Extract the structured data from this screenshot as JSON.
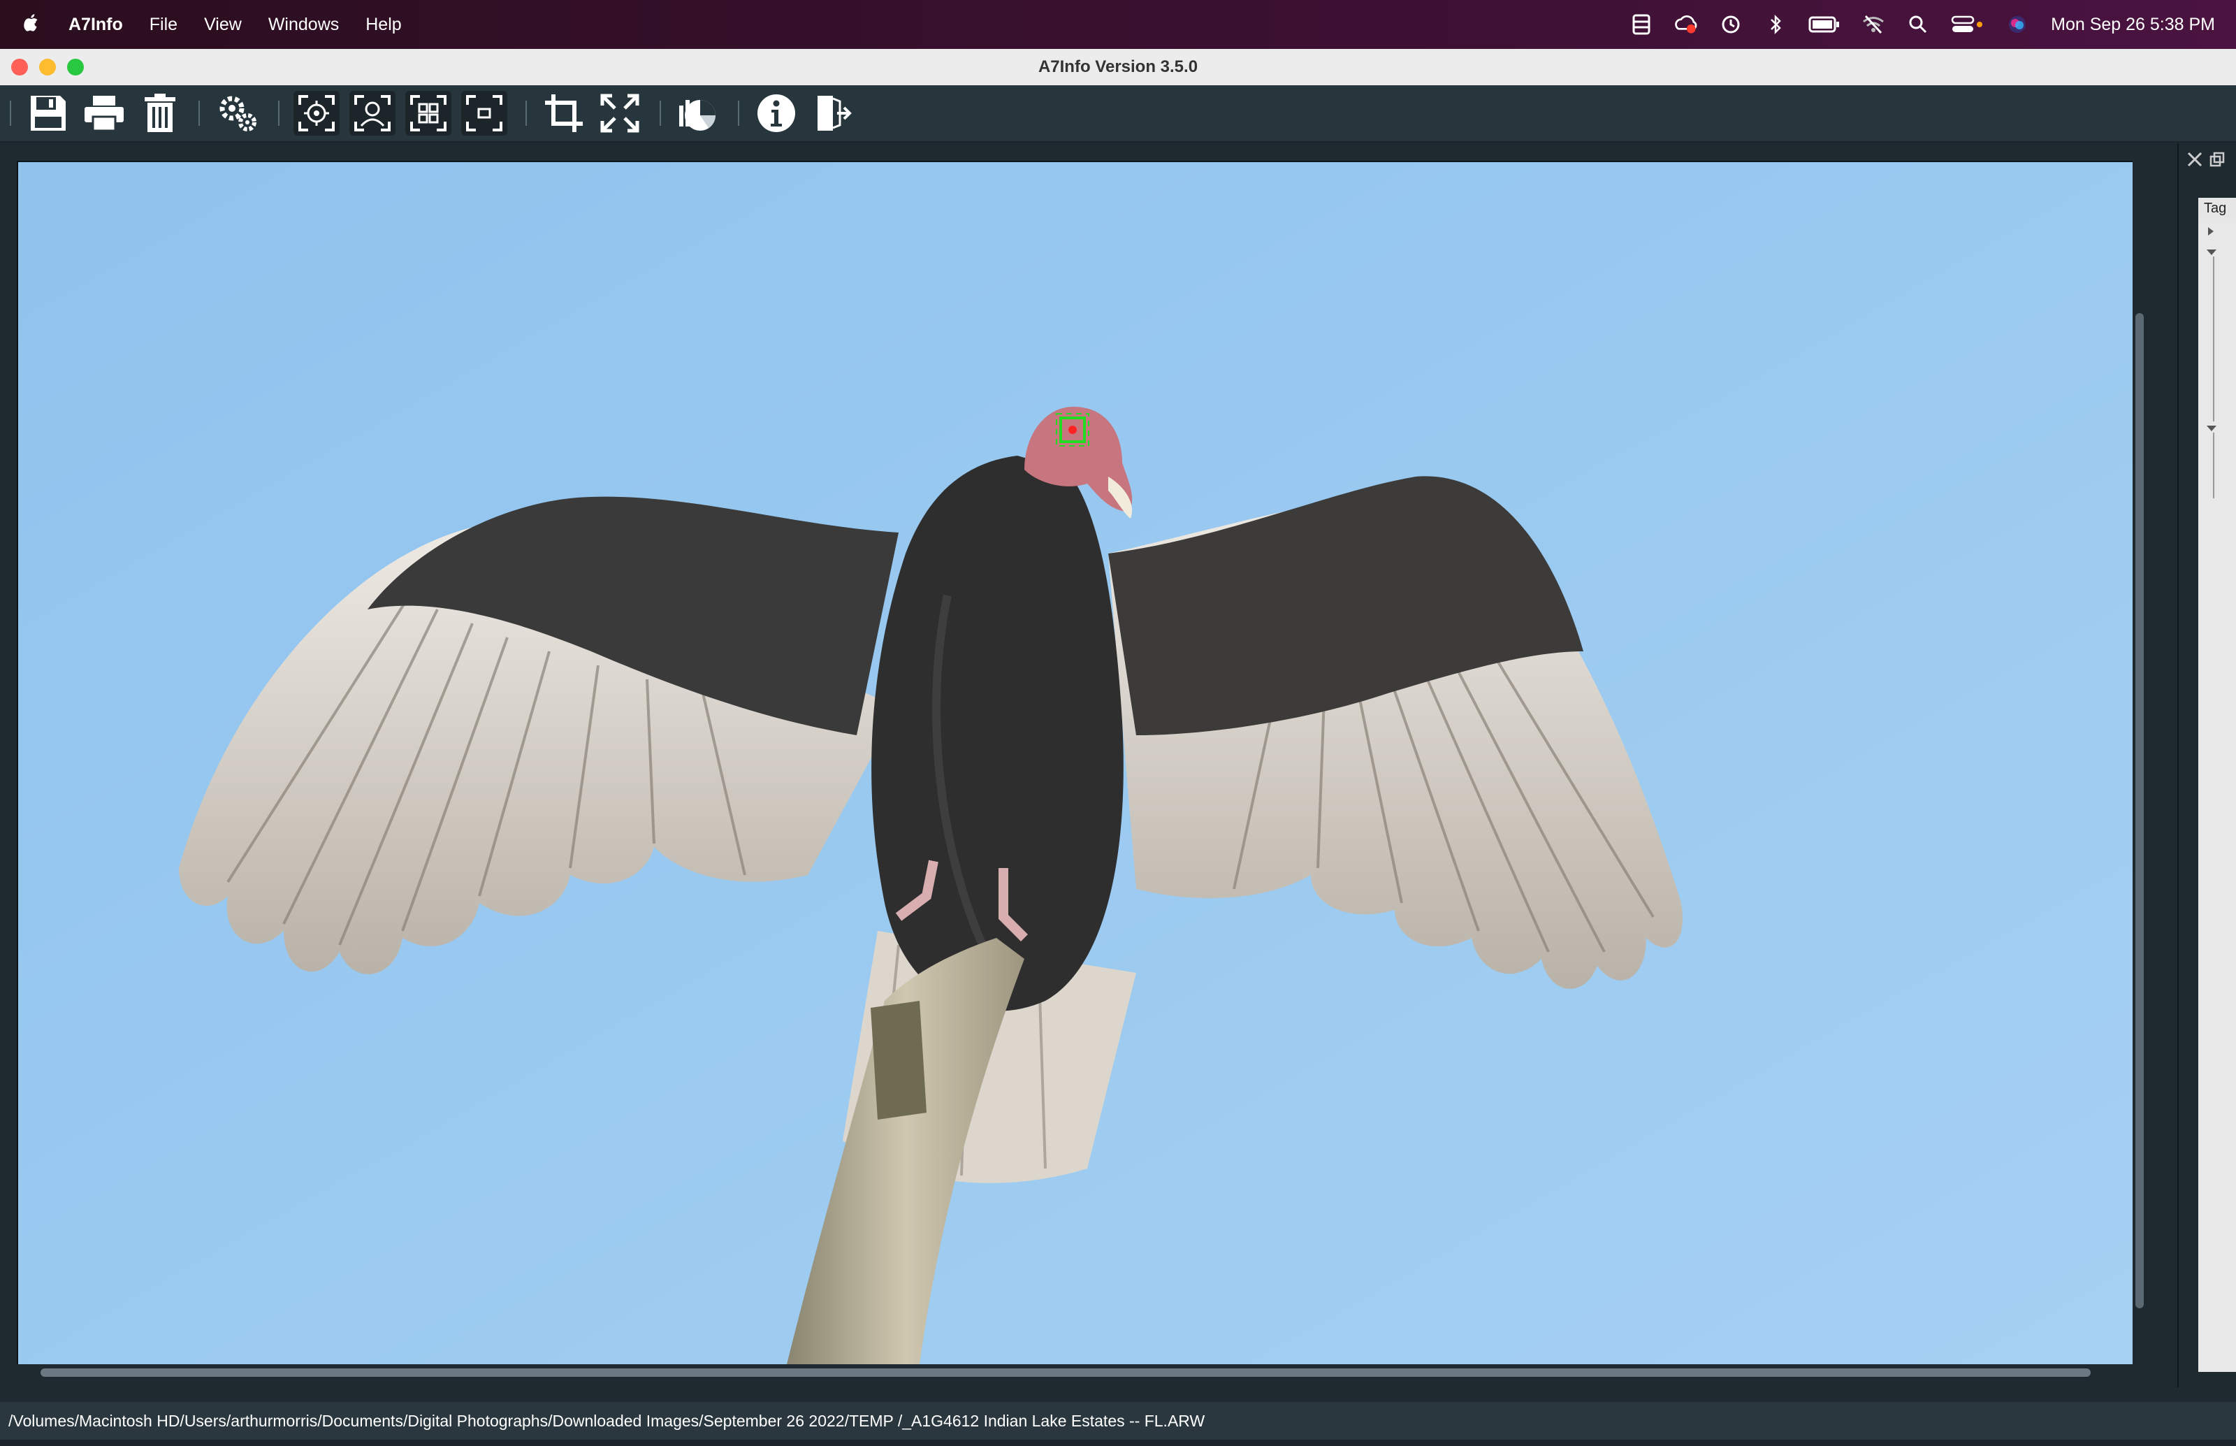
{
  "menubar": {
    "app_name": "A7Info",
    "menus": [
      "File",
      "View",
      "Windows",
      "Help"
    ],
    "clock": "Mon Sep 26  5:38 PM",
    "icons": [
      "display-icon",
      "cloud-sync-icon",
      "time-machine-icon",
      "bluetooth-icon",
      "battery-icon",
      "wifi-off-icon",
      "search-icon",
      "control-center-icon",
      "siri-icon"
    ]
  },
  "window": {
    "title": "A7Info Version 3.5.0",
    "traffic_lights": {
      "close": "#fe5f57",
      "minimize": "#febc2e",
      "zoom": "#28c840"
    }
  },
  "toolbar": {
    "buttons": [
      {
        "name": "save-icon"
      },
      {
        "name": "print-icon"
      },
      {
        "name": "trash-icon"
      },
      {
        "name": "settings-gears-icon"
      },
      {
        "name": "focus-point-icon"
      },
      {
        "name": "face-detect-icon"
      },
      {
        "name": "focus-area-icon"
      },
      {
        "name": "focus-frame-icon"
      },
      {
        "name": "crop-icon"
      },
      {
        "name": "fullscreen-icon"
      },
      {
        "name": "exposure-chart-icon"
      },
      {
        "name": "info-icon"
      },
      {
        "name": "exit-icon"
      }
    ]
  },
  "side_panel": {
    "tab_label": "Tag"
  },
  "status_bar": {
    "path": "/Volumes/Macintosh HD/Users/arthurmorris/Documents/Digital Photographs/Downloaded Images/September 26 2022/TEMP /_A1G4612  Indian Lake Estates -- FL.ARW"
  },
  "colors": {
    "sky": "#9ecbf0",
    "toolbar_bg": "#27363d",
    "focus_marker": "#22dd22"
  }
}
